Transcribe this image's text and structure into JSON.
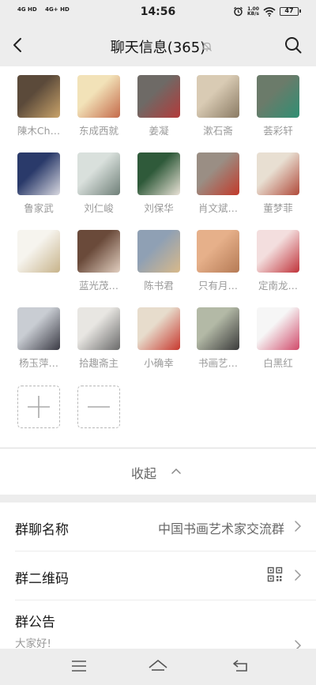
{
  "status_bar": {
    "net1": "4G HD",
    "net2": "4G+ HD",
    "time": "14:56",
    "speed_value": "1.00",
    "speed_unit": "KB/s",
    "battery": "47"
  },
  "nav": {
    "title": "聊天信息(365)"
  },
  "members": [
    {
      "name": "陳木Ch…",
      "colors": [
        "#5b4a3a",
        "#c9a36a"
      ]
    },
    {
      "name": "东成西就",
      "colors": [
        "#f2e2b8",
        "#c46a4a"
      ]
    },
    {
      "name": "姜凝",
      "colors": [
        "#6e6a66",
        "#b33a3a"
      ]
    },
    {
      "name": "漱石斋",
      "colors": [
        "#d9cbb4",
        "#8a7a63"
      ]
    },
    {
      "name": "荟彩轩",
      "colors": [
        "#6b7b6a",
        "#2f8f73"
      ]
    },
    {
      "name": "鲁家武",
      "colors": [
        "#2a3a6a",
        "#d8d8e0"
      ]
    },
    {
      "name": "刘仁峻",
      "colors": [
        "#d9e0dc",
        "#6f7f78"
      ]
    },
    {
      "name": "刘保华",
      "colors": [
        "#2f5a3a",
        "#e9e2d6"
      ]
    },
    {
      "name": "肖文斌…",
      "colors": [
        "#9a8e84",
        "#c23a2a"
      ]
    },
    {
      "name": "董梦菲",
      "colors": [
        "#e8dfd2",
        "#b04a3a"
      ]
    },
    {
      "name": "",
      "colors": [
        "#f6f4ee",
        "#c7b38a"
      ]
    },
    {
      "name": "蓝光茂…",
      "colors": [
        "#6a4a3a",
        "#e2cfc0"
      ]
    },
    {
      "name": "陈书君",
      "colors": [
        "#8fa0b4",
        "#d8b98a"
      ]
    },
    {
      "name": "只有月…",
      "colors": [
        "#e6b08a",
        "#b57a55"
      ]
    },
    {
      "name": "定南龙…",
      "colors": [
        "#f3dede",
        "#c0333a"
      ]
    },
    {
      "name": "杨玉萍…",
      "colors": [
        "#c9cdd3",
        "#3a3a44"
      ]
    },
    {
      "name": "拾趣斋主",
      "colors": [
        "#e8e6e2",
        "#6a6a6a"
      ]
    },
    {
      "name": "小确幸",
      "colors": [
        "#e7dccc",
        "#c7382e"
      ]
    },
    {
      "name": "书画艺…",
      "colors": [
        "#b3b9a6",
        "#3a3a3a"
      ]
    },
    {
      "name": "白黑红",
      "colors": [
        "#f6f6f6",
        "#d14a6a"
      ]
    }
  ],
  "collapse": {
    "label": "收起"
  },
  "settings": {
    "group_name_label": "群聊名称",
    "group_name_value": "中国书画艺术家交流群",
    "qr_label": "群二维码",
    "notice_label": "群公告",
    "notice_text": "大家好!"
  },
  "icons": {
    "back": "back-arrow-icon",
    "mute": "bell-muted-icon",
    "search": "search-icon",
    "add": "plus-icon",
    "remove": "minus-icon",
    "collapse": "chevron-up-icon",
    "qr": "qr-code-icon",
    "chevron": "chevron-right-icon",
    "menu": "menu-icon",
    "home": "home-icon",
    "back_nav": "return-icon"
  }
}
